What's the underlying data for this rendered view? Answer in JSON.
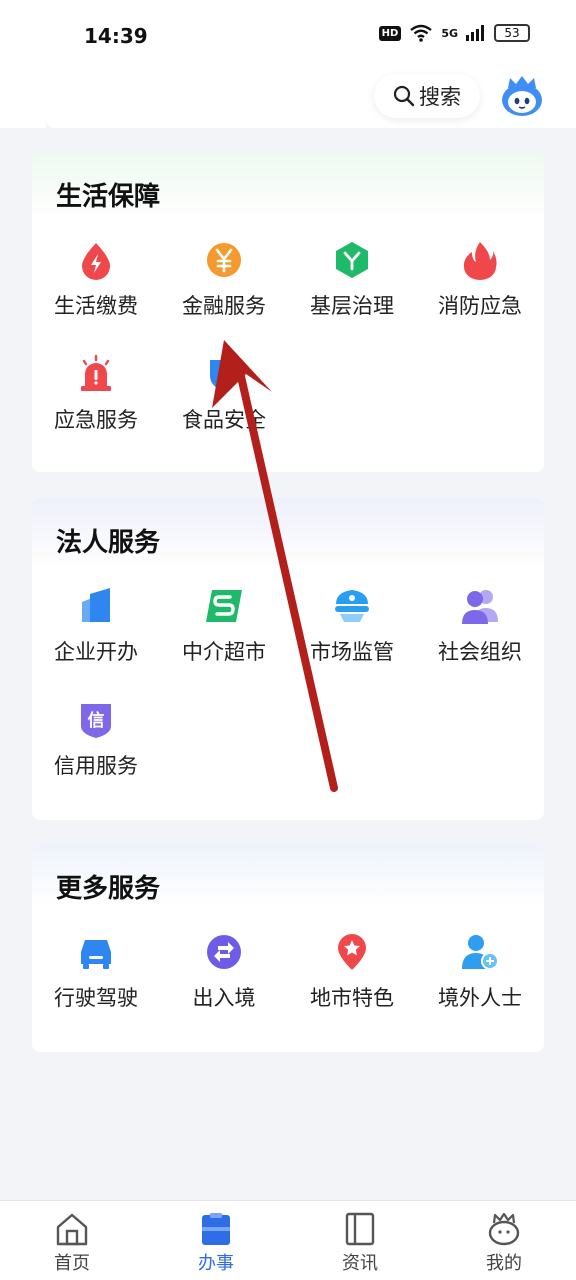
{
  "status_bar": {
    "time": "14:39",
    "network": "5G",
    "hd": "HD",
    "battery": "53"
  },
  "header": {
    "search_label": "搜索",
    "search_icon": "search-icon",
    "avatar_icon": "mascot-avatar-icon"
  },
  "sections": [
    {
      "title": "生活保障",
      "items": [
        {
          "label": "生活缴费",
          "icon": "flash-drop-icon",
          "color": "#f0474d"
        },
        {
          "label": "金融服务",
          "icon": "yen-coin-icon",
          "color": "#f59a2e"
        },
        {
          "label": "基层治理",
          "icon": "hexagon-icon",
          "color": "#1fb96a"
        },
        {
          "label": "消防应急",
          "icon": "flame-icon",
          "color": "#f0474d"
        },
        {
          "label": "应急服务",
          "icon": "alarm-siren-icon",
          "color": "#f0474d"
        },
        {
          "label": "食品安全",
          "icon": "food-shield-icon",
          "color": "#2f86f0"
        }
      ]
    },
    {
      "title": "法人服务",
      "items": [
        {
          "label": "企业开办",
          "icon": "building-icon",
          "color": "#2f86f0"
        },
        {
          "label": "中介超市",
          "icon": "agency-s-icon",
          "color": "#1fb96a"
        },
        {
          "label": "市场监管",
          "icon": "officer-cap-icon",
          "color": "#2a9ff0"
        },
        {
          "label": "社会组织",
          "icon": "people-icon",
          "color": "#7c68e8"
        },
        {
          "label": "信用服务",
          "icon": "credit-badge-icon",
          "color": "#7c68e8"
        }
      ]
    },
    {
      "title": "更多服务",
      "items": [
        {
          "label": "行驶驾驶",
          "icon": "car-icon",
          "color": "#2f86f0"
        },
        {
          "label": "出入境",
          "icon": "exit-entry-icon",
          "color": "#6f5ce6"
        },
        {
          "label": "地市特色",
          "icon": "location-star-icon",
          "color": "#f0474d"
        },
        {
          "label": "境外人士",
          "icon": "foreign-person-icon",
          "color": "#2f9ef0"
        }
      ]
    }
  ],
  "bottom_nav": [
    {
      "label": "首页",
      "icon": "home-icon",
      "active": false
    },
    {
      "label": "办事",
      "icon": "briefcase-icon",
      "active": true
    },
    {
      "label": "资讯",
      "icon": "news-book-icon",
      "active": false
    },
    {
      "label": "我的",
      "icon": "profile-mascot-icon",
      "active": false
    }
  ],
  "annotation_arrow_color": "#b3201c"
}
